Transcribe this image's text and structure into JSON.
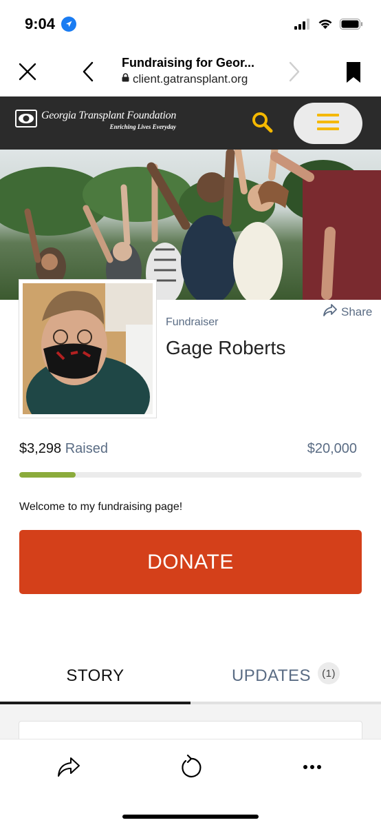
{
  "status_bar": {
    "time": "9:04"
  },
  "browser": {
    "page_title": "Fundraising for Geor...",
    "url": "client.gatransplant.org"
  },
  "site": {
    "logo_name": "Georgia Transplant Foundation",
    "logo_tagline": "Enriching Lives Everyday",
    "accent_color": "#f5b800",
    "header_bg": "#2b2b2b"
  },
  "profile": {
    "share_label": "Share",
    "role": "Fundraiser",
    "name": "Gage Roberts"
  },
  "fundraising": {
    "raised_amount": "$3,298",
    "raised_label": "Raised",
    "goal": "$20,000",
    "progress_fraction": 0.165,
    "progress_color": "#8bab3b"
  },
  "welcome_text": "Welcome to my fundraising page!",
  "donate_label": "DONATE",
  "donate_color": "#d4401a",
  "tabs": {
    "story": "STORY",
    "updates": "UPDATES",
    "updates_count": "(1)"
  },
  "icons": {
    "close": "close-icon",
    "back": "back-icon",
    "forward": "forward-icon",
    "bookmark": "bookmark-icon",
    "search": "search-icon",
    "menu": "hamburger-menu-icon",
    "share": "share-icon",
    "reload": "reload-icon",
    "more": "more-icon"
  }
}
